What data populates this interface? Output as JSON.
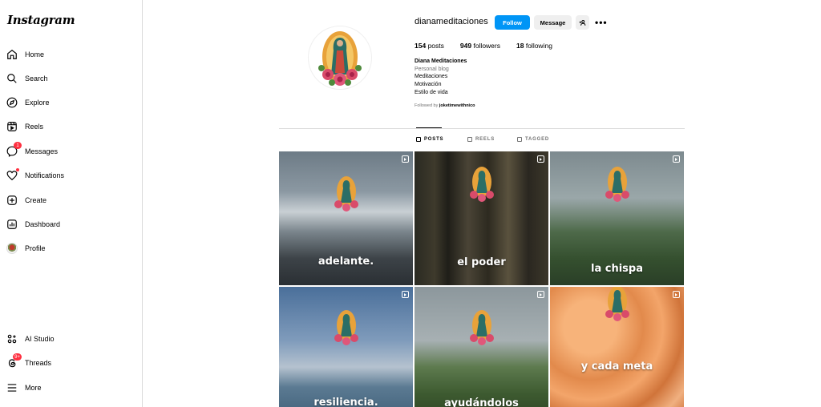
{
  "app": {
    "logo": "Instagram"
  },
  "nav": {
    "items": [
      {
        "label": "Home",
        "icon": "home-icon"
      },
      {
        "label": "Search",
        "icon": "search-icon"
      },
      {
        "label": "Explore",
        "icon": "compass-icon"
      },
      {
        "label": "Reels",
        "icon": "reels-icon"
      },
      {
        "label": "Messages",
        "icon": "messenger-icon",
        "badge": "1"
      },
      {
        "label": "Notifications",
        "icon": "heart-icon"
      },
      {
        "label": "Create",
        "icon": "plus-square-icon"
      },
      {
        "label": "Dashboard",
        "icon": "dashboard-icon"
      },
      {
        "label": "Profile",
        "icon": "avatar"
      }
    ],
    "bottom": [
      {
        "label": "AI Studio",
        "icon": "ai-studio-icon"
      },
      {
        "label": "Threads",
        "icon": "threads-icon",
        "badge": "9+"
      },
      {
        "label": "More",
        "icon": "menu-icon"
      }
    ]
  },
  "profile": {
    "username": "dianameditaciones",
    "follow_label": "Follow",
    "message_label": "Message",
    "posts_count": "154",
    "posts_label": "posts",
    "followers_count": "949",
    "followers_label": "followers",
    "following_count": "18",
    "following_label": "following",
    "display_name": "Diana Meditaciones",
    "category": "Personal blog",
    "bio_lines": [
      "Meditaciones",
      "Motivación",
      "Estilo de vida"
    ],
    "followed_by_prefix": "Followed by",
    "followed_by_user": "joketimewithnico"
  },
  "tabs": [
    {
      "label": "POSTS",
      "active": true
    },
    {
      "label": "REELS",
      "active": false
    },
    {
      "label": "TAGGED",
      "active": false
    }
  ],
  "posts": [
    {
      "caption": "adelante.",
      "scene": "snowy mountains"
    },
    {
      "caption": "el poder",
      "scene": "dark forest"
    },
    {
      "caption": "la chispa",
      "scene": "palm trees"
    },
    {
      "caption": "resiliencia.",
      "scene": "lake shore"
    },
    {
      "caption": "ayudándolos",
      "scene": "green valley"
    },
    {
      "caption": "y cada meta",
      "scene": "orange roses"
    }
  ],
  "colors": {
    "accent": "#0095f6",
    "badge": "#ff3040",
    "border": "#dbdbdb",
    "muted": "#737373"
  }
}
